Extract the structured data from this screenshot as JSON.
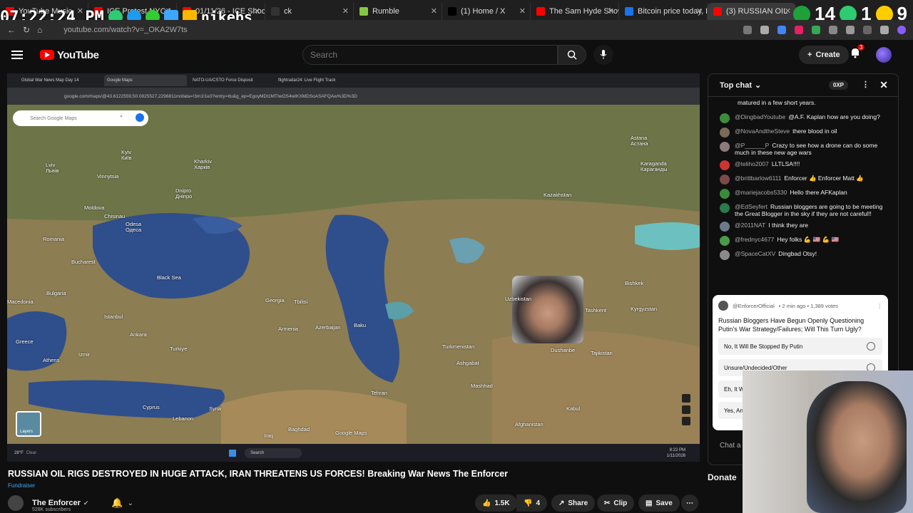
{
  "browser": {
    "tabs": [
      {
        "label": "YouTube Music",
        "color": "#ff0000"
      },
      {
        "label": "ICE Protest NYC L",
        "color": "#ff0000"
      },
      {
        "label": "01/11/26 - ICE Shooti",
        "color": "#ff0000"
      },
      {
        "label": "ck",
        "color": "#333333"
      },
      {
        "label": "Rumble",
        "color": "#85c742"
      },
      {
        "label": "(1) Home / X",
        "color": "#000000"
      },
      {
        "label": "The Sam Hyde Show",
        "color": "#ff0000"
      },
      {
        "label": "Bitcoin price today, B",
        "color": "#1a73e8"
      },
      {
        "label": "(3) RUSSIAN OIL",
        "color": "#ff0000"
      }
    ],
    "url": "youtube.com/watch?v=_OKA2W7ts"
  },
  "overlay": {
    "clock": "07:22:24 PM",
    "handle": "nikebs",
    "counter_a": "14",
    "counter_b": "1",
    "counter_c": "9"
  },
  "youtube": {
    "logo": "YouTube",
    "search_placeholder": "Search",
    "create_label": "Create",
    "notification_count": "3"
  },
  "player": {
    "inner_tabs": [
      "Global War News Map Day 14",
      "Google Maps",
      "NATO-UA/CSTO Force Disposit",
      "flightradar24: Live Flight Track"
    ],
    "inner_url": "google.com/maps/@43.6122559,50.0825527,2296811m/data=!3m1!1e3?entry=ttu&g_ep=EgoyMDI1MTIwOS4wIKXMDSoASAFQAw%3D%3D",
    "map_search": "Search Google Maps",
    "layers_label": "Layers",
    "labels": [
      {
        "t": "Kyiv",
        "pos": "a"
      },
      {
        "t": "Київ",
        "pos": "a2"
      },
      {
        "t": "Kharkiv",
        "pos": "b"
      },
      {
        "t": "Харків",
        "pos": "b2"
      },
      {
        "t": "Lviv",
        "pos": "c"
      },
      {
        "t": "Львів",
        "pos": "c2"
      },
      {
        "t": "Vinnytsia",
        "pos": "c3"
      },
      {
        "t": "Dnipro",
        "pos": "d"
      },
      {
        "t": "Дніпро",
        "pos": "d2"
      },
      {
        "t": "Moldova",
        "pos": "e"
      },
      {
        "t": "Chisinau",
        "pos": "e2"
      },
      {
        "t": "Odesa",
        "pos": "f"
      },
      {
        "t": "Одеса",
        "pos": "f2"
      },
      {
        "t": "Romania",
        "pos": "g"
      },
      {
        "t": "Bucharest",
        "pos": "h"
      },
      {
        "t": "Black Sea",
        "pos": "i"
      },
      {
        "t": "Bulgaria",
        "pos": "j"
      },
      {
        "t": "Georgia",
        "pos": "k"
      },
      {
        "t": "Tbilisi",
        "pos": "k2"
      },
      {
        "t": "Armenia",
        "pos": "l"
      },
      {
        "t": "Azerbaijan",
        "pos": "m"
      },
      {
        "t": "Baku",
        "pos": "n"
      },
      {
        "t": "Istanbul",
        "pos": "o"
      },
      {
        "t": "Ankara",
        "pos": "p"
      },
      {
        "t": "Turkiye",
        "pos": "q"
      },
      {
        "t": "Greece",
        "pos": "r"
      },
      {
        "t": "Athens",
        "pos": "s"
      },
      {
        "t": "Izmir",
        "pos": "s2"
      },
      {
        "t": "Cyprus",
        "pos": "t"
      },
      {
        "t": "Syria",
        "pos": "u"
      },
      {
        "t": "Lebanon",
        "pos": "v"
      },
      {
        "t": "Iraq",
        "pos": "w"
      },
      {
        "t": "Baghdad",
        "pos": "w2"
      },
      {
        "t": "Tehran",
        "pos": "x"
      },
      {
        "t": "Turkmenistan",
        "pos": "y"
      },
      {
        "t": "Ashgabat",
        "pos": "z"
      },
      {
        "t": "Mashhad",
        "pos": "z2"
      },
      {
        "t": "Kazakhstan",
        "pos": "aa"
      },
      {
        "t": "Astana",
        "pos": "ab"
      },
      {
        "t": "Астана",
        "pos": "ab2"
      },
      {
        "t": "Karaganda",
        "pos": "ac"
      },
      {
        "t": "Караганды",
        "pos": "ac2"
      },
      {
        "t": "Uzbekistan",
        "pos": "ad"
      },
      {
        "t": "Tashkent",
        "pos": "ae"
      },
      {
        "t": "Bishkek",
        "pos": "ae2"
      },
      {
        "t": "Kyrgyzstan",
        "pos": "af"
      },
      {
        "t": "Dushanbe",
        "pos": "ag"
      },
      {
        "t": "Tajikistan",
        "pos": "ag2"
      },
      {
        "t": "Afghanistan",
        "pos": "ah"
      },
      {
        "t": "Kabul",
        "pos": "ah2"
      },
      {
        "t": "Macedonia",
        "pos": "ai"
      },
      {
        "t": "Google Maps",
        "pos": "aj"
      }
    ],
    "taskbar": {
      "weather": "28°F",
      "weather_sub": "Clear",
      "search": "Search",
      "time": "8:22 PM",
      "date": "1/11/2026"
    }
  },
  "video": {
    "title": "RUSSIAN OIL RIGS DESTROYED IN HUGE ATTACK, IRAN THREATENS US FORCES! Breaking War News The Enforcer",
    "fundraiser": "Fundraiser",
    "channel": "The Enforcer",
    "subscribers": "528K subscribers",
    "likes": "1.5K",
    "dislike_count": "4",
    "share_label": "Share",
    "clip_label": "Clip",
    "save_label": "Save"
  },
  "chat": {
    "header": "Top chat",
    "points": "0XP",
    "messages": [
      {
        "name": "",
        "text": "matured in a few short years.",
        "color": "#0f0f0f"
      },
      {
        "name": "@DingbadYoutube",
        "text": "@A.F. Kaplan how are you doing?",
        "color": "#3c8c3c"
      },
      {
        "name": "@NovaAndtheSteve",
        "text": "there blood in oil",
        "color": "#7a6a5a"
      },
      {
        "name": "@P______P",
        "text": "Crazy to see how a drone can do some much in these new age wars",
        "color": "#8a7a7a"
      },
      {
        "name": "@teliho2007",
        "text": "LLTLSA!!!!",
        "color": "#cc3333"
      },
      {
        "name": "@brittbarlow6111",
        "text": "Enforcer 👍 Enforcer Matt 👍",
        "color": "#7a4a4a"
      },
      {
        "name": "@mariejacobs5330",
        "text": "Hello there AFKaplan",
        "color": "#3a8a3a"
      },
      {
        "name": "@EdSeyfert",
        "text": "Russian bloggers are going to be meeting the Great Blogger in the sky if they are not careful!!",
        "color": "#2a7a4a"
      },
      {
        "name": "@2011NAT",
        "text": "I think they are",
        "color": "#6a7a8a"
      },
      {
        "name": "@frednyc4677",
        "text": "Hey folks 💪 🇺🇸 💪 🇺🇸",
        "color": "#4a9a4a"
      },
      {
        "name": "@SpaceCatXV",
        "text": "Dingbad Otsy!",
        "color": "#8a8a8a"
      }
    ],
    "poll": {
      "author": "@EnforcerOfficial",
      "meta": "• 2 min ago • 1,389 votes",
      "question": "Russian Bloggers Have Begun Openly Questioning Putin's War Strategy/Failures; Will This Turn Ugly?",
      "options": [
        "No, It Will Be Stopped By Putin",
        "Unsure/Undecided/Other",
        "Eh, It W",
        "Yes, An"
      ]
    },
    "input_placeholder": "Chat a",
    "donate": "Donate"
  }
}
